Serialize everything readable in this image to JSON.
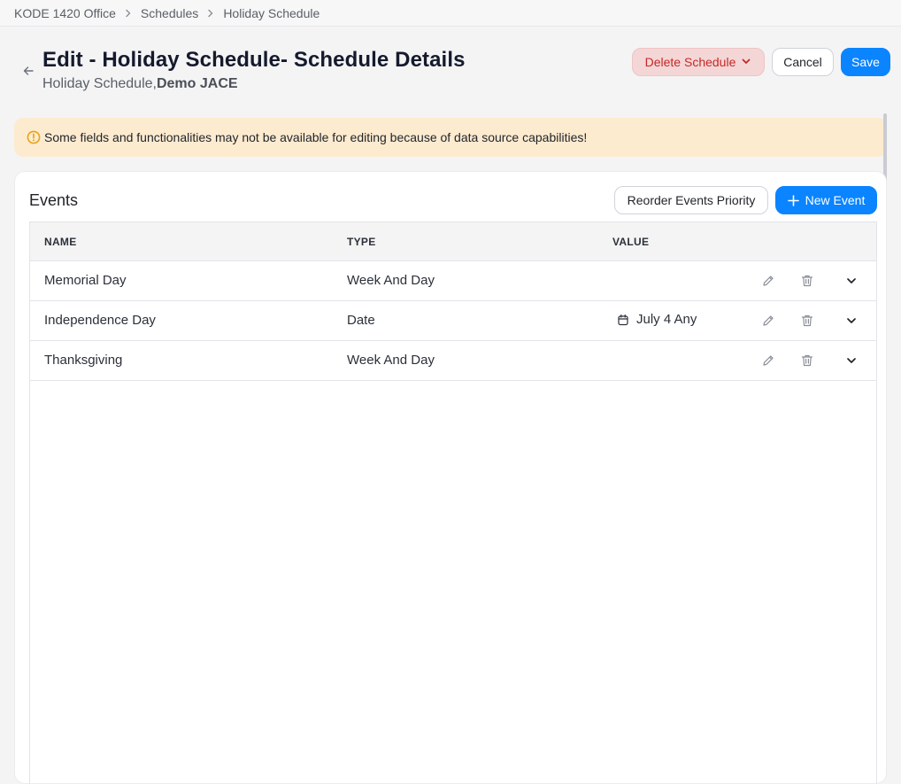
{
  "breadcrumb": {
    "items": [
      "KODE 1420 Office",
      "Schedules",
      "Holiday Schedule"
    ]
  },
  "header": {
    "title": "Edit - Holiday Schedule- Schedule Details",
    "subtitle_prefix": "Holiday Schedule,",
    "subtitle_bold": "Demo JACE"
  },
  "actions": {
    "delete_label": "Delete Schedule",
    "cancel_label": "Cancel",
    "save_label": "Save"
  },
  "warning": {
    "text": "Some fields and functionalities may not be available for editing because of data source capabilities!"
  },
  "events": {
    "title": "Events",
    "reorder_label": "Reorder Events Priority",
    "new_label": "New Event",
    "columns": {
      "name": "NAME",
      "type": "TYPE",
      "value": "VALUE"
    },
    "rows": [
      {
        "name": "Memorial Day",
        "type": "Week And Day",
        "value": ""
      },
      {
        "name": "Independence Day",
        "type": "Date",
        "value": "July 4 Any"
      },
      {
        "name": "Thanksgiving",
        "type": "Week And Day",
        "value": ""
      }
    ]
  },
  "colors": {
    "accent": "#0a84ff",
    "danger": "#c62828",
    "danger_bg": "#f4d6d6",
    "warning_bg": "#fdebd0",
    "warning_icon": "#e8a317"
  },
  "icons": [
    "chevron-right-icon",
    "arrow-left-icon",
    "chevron-down-icon",
    "warning-circle-icon",
    "plus-icon",
    "calendar-icon",
    "pencil-icon",
    "trash-icon"
  ]
}
